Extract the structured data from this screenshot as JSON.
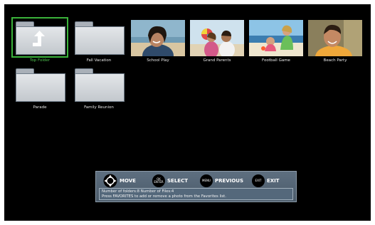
{
  "folders_row1": [
    {
      "label": "Top Folder",
      "type": "up",
      "selected": true
    },
    {
      "label": "Fall Vacation",
      "type": "folder"
    },
    {
      "label": "School Play",
      "type": "folder"
    },
    {
      "label": "Grand Parents",
      "type": "folder"
    },
    {
      "label": "Football Game",
      "type": "folder"
    },
    {
      "label": "Beach Party",
      "type": "folder"
    }
  ],
  "row2": [
    {
      "label": "Parade",
      "type": "folder"
    },
    {
      "label": "Family Reunion",
      "type": "folder"
    },
    {
      "label": "",
      "type": "photo",
      "photo": "woman-smiling"
    },
    {
      "label": "",
      "type": "photo",
      "photo": "couple-beach-ball"
    },
    {
      "label": "",
      "type": "photo",
      "photo": "family-beach"
    },
    {
      "label": "",
      "type": "photo",
      "photo": "man-smiling"
    }
  ],
  "controls": {
    "move_label": "MOVE",
    "ok_button_top": "OK",
    "ok_button_bottom": "ENTER",
    "select_label": "SELECT",
    "menu_button": "MENU",
    "previous_label": "PREVIOUS",
    "exit_button": "EXIT",
    "exit_label": "EXIT"
  },
  "info": {
    "counts": "Number of folders:8 Number of Files:4",
    "hint": "Press FAVORITES to add or remove a photo from the Favorites list."
  },
  "colors": {
    "selection": "#3bb33b",
    "panel": "#4f6070",
    "screen": "#000000"
  }
}
